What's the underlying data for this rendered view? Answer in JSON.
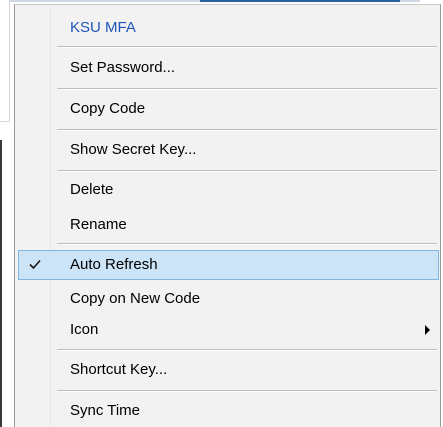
{
  "menu": {
    "header_label": "KSU MFA",
    "items": {
      "set_password": "Set Password...",
      "copy_code": "Copy Code",
      "show_secret_key": "Show Secret Key...",
      "delete": "Delete",
      "rename": "Rename",
      "auto_refresh": "Auto Refresh",
      "copy_on_new_code": "Copy on New Code",
      "icon": "Icon",
      "shortcut_key": "Shortcut Key...",
      "sync_time": "Sync Time"
    },
    "auto_refresh_checked": true,
    "icons": {
      "check": "check-icon",
      "submenu_arrow": "submenu-arrow-icon"
    },
    "colors": {
      "header_text": "#1f55b8",
      "highlight_fill": "#cce4f7",
      "highlight_border": "#7fb4e3",
      "menu_background": "#f2f2f2"
    }
  }
}
